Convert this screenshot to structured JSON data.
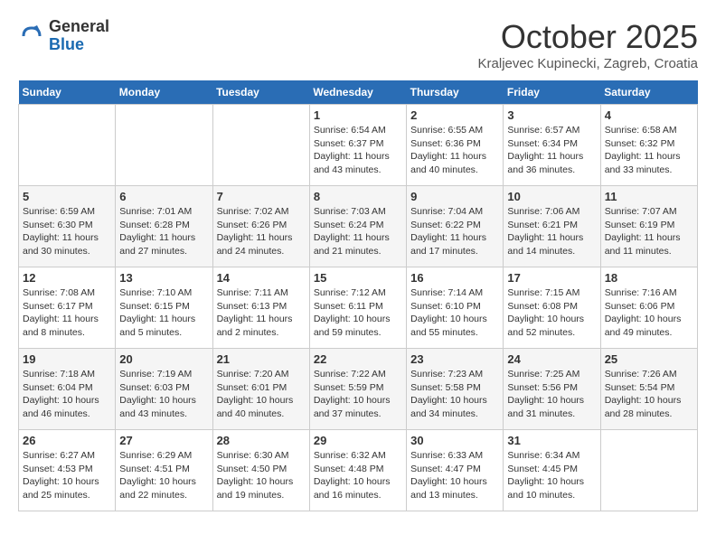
{
  "header": {
    "logo_general": "General",
    "logo_blue": "Blue",
    "month": "October 2025",
    "location": "Kraljevec Kupinecki, Zagreb, Croatia"
  },
  "days_of_week": [
    "Sunday",
    "Monday",
    "Tuesday",
    "Wednesday",
    "Thursday",
    "Friday",
    "Saturday"
  ],
  "weeks": [
    [
      {
        "day": "",
        "info": ""
      },
      {
        "day": "",
        "info": ""
      },
      {
        "day": "",
        "info": ""
      },
      {
        "day": "1",
        "info": "Sunrise: 6:54 AM\nSunset: 6:37 PM\nDaylight: 11 hours\nand 43 minutes."
      },
      {
        "day": "2",
        "info": "Sunrise: 6:55 AM\nSunset: 6:36 PM\nDaylight: 11 hours\nand 40 minutes."
      },
      {
        "day": "3",
        "info": "Sunrise: 6:57 AM\nSunset: 6:34 PM\nDaylight: 11 hours\nand 36 minutes."
      },
      {
        "day": "4",
        "info": "Sunrise: 6:58 AM\nSunset: 6:32 PM\nDaylight: 11 hours\nand 33 minutes."
      }
    ],
    [
      {
        "day": "5",
        "info": "Sunrise: 6:59 AM\nSunset: 6:30 PM\nDaylight: 11 hours\nand 30 minutes."
      },
      {
        "day": "6",
        "info": "Sunrise: 7:01 AM\nSunset: 6:28 PM\nDaylight: 11 hours\nand 27 minutes."
      },
      {
        "day": "7",
        "info": "Sunrise: 7:02 AM\nSunset: 6:26 PM\nDaylight: 11 hours\nand 24 minutes."
      },
      {
        "day": "8",
        "info": "Sunrise: 7:03 AM\nSunset: 6:24 PM\nDaylight: 11 hours\nand 21 minutes."
      },
      {
        "day": "9",
        "info": "Sunrise: 7:04 AM\nSunset: 6:22 PM\nDaylight: 11 hours\nand 17 minutes."
      },
      {
        "day": "10",
        "info": "Sunrise: 7:06 AM\nSunset: 6:21 PM\nDaylight: 11 hours\nand 14 minutes."
      },
      {
        "day": "11",
        "info": "Sunrise: 7:07 AM\nSunset: 6:19 PM\nDaylight: 11 hours\nand 11 minutes."
      }
    ],
    [
      {
        "day": "12",
        "info": "Sunrise: 7:08 AM\nSunset: 6:17 PM\nDaylight: 11 hours\nand 8 minutes."
      },
      {
        "day": "13",
        "info": "Sunrise: 7:10 AM\nSunset: 6:15 PM\nDaylight: 11 hours\nand 5 minutes."
      },
      {
        "day": "14",
        "info": "Sunrise: 7:11 AM\nSunset: 6:13 PM\nDaylight: 11 hours\nand 2 minutes."
      },
      {
        "day": "15",
        "info": "Sunrise: 7:12 AM\nSunset: 6:11 PM\nDaylight: 10 hours\nand 59 minutes."
      },
      {
        "day": "16",
        "info": "Sunrise: 7:14 AM\nSunset: 6:10 PM\nDaylight: 10 hours\nand 55 minutes."
      },
      {
        "day": "17",
        "info": "Sunrise: 7:15 AM\nSunset: 6:08 PM\nDaylight: 10 hours\nand 52 minutes."
      },
      {
        "day": "18",
        "info": "Sunrise: 7:16 AM\nSunset: 6:06 PM\nDaylight: 10 hours\nand 49 minutes."
      }
    ],
    [
      {
        "day": "19",
        "info": "Sunrise: 7:18 AM\nSunset: 6:04 PM\nDaylight: 10 hours\nand 46 minutes."
      },
      {
        "day": "20",
        "info": "Sunrise: 7:19 AM\nSunset: 6:03 PM\nDaylight: 10 hours\nand 43 minutes."
      },
      {
        "day": "21",
        "info": "Sunrise: 7:20 AM\nSunset: 6:01 PM\nDaylight: 10 hours\nand 40 minutes."
      },
      {
        "day": "22",
        "info": "Sunrise: 7:22 AM\nSunset: 5:59 PM\nDaylight: 10 hours\nand 37 minutes."
      },
      {
        "day": "23",
        "info": "Sunrise: 7:23 AM\nSunset: 5:58 PM\nDaylight: 10 hours\nand 34 minutes."
      },
      {
        "day": "24",
        "info": "Sunrise: 7:25 AM\nSunset: 5:56 PM\nDaylight: 10 hours\nand 31 minutes."
      },
      {
        "day": "25",
        "info": "Sunrise: 7:26 AM\nSunset: 5:54 PM\nDaylight: 10 hours\nand 28 minutes."
      }
    ],
    [
      {
        "day": "26",
        "info": "Sunrise: 6:27 AM\nSunset: 4:53 PM\nDaylight: 10 hours\nand 25 minutes."
      },
      {
        "day": "27",
        "info": "Sunrise: 6:29 AM\nSunset: 4:51 PM\nDaylight: 10 hours\nand 22 minutes."
      },
      {
        "day": "28",
        "info": "Sunrise: 6:30 AM\nSunset: 4:50 PM\nDaylight: 10 hours\nand 19 minutes."
      },
      {
        "day": "29",
        "info": "Sunrise: 6:32 AM\nSunset: 4:48 PM\nDaylight: 10 hours\nand 16 minutes."
      },
      {
        "day": "30",
        "info": "Sunrise: 6:33 AM\nSunset: 4:47 PM\nDaylight: 10 hours\nand 13 minutes."
      },
      {
        "day": "31",
        "info": "Sunrise: 6:34 AM\nSunset: 4:45 PM\nDaylight: 10 hours\nand 10 minutes."
      },
      {
        "day": "",
        "info": ""
      }
    ]
  ]
}
